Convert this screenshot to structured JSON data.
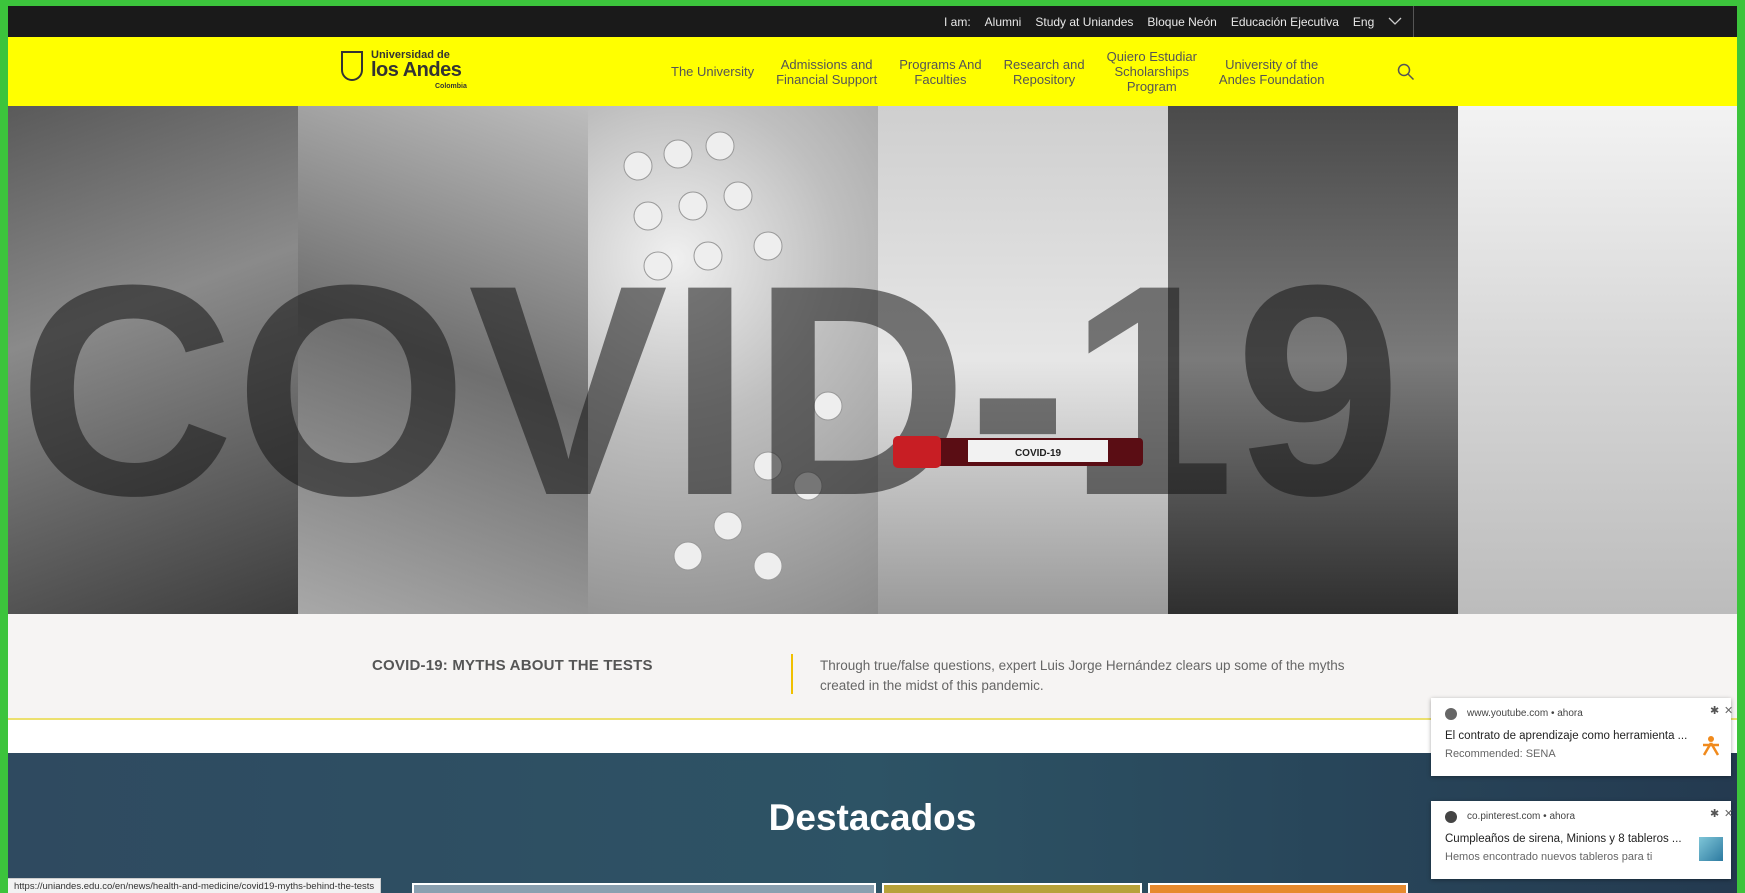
{
  "topbar": {
    "iam_label": "I am:",
    "links": [
      "Alumni",
      "Study at Uniandes",
      "Bloque Neón",
      "Educación Ejecutiva"
    ],
    "language": "Eng"
  },
  "logo": {
    "line1": "Universidad de",
    "line2": "los Andes",
    "line3": "Colombia"
  },
  "nav": {
    "items": [
      {
        "line1": "The University",
        "line2": "",
        "line3": ""
      },
      {
        "line1": "Admissions and",
        "line2": "Financial Support",
        "line3": ""
      },
      {
        "line1": "Programs And",
        "line2": "Faculties",
        "line3": ""
      },
      {
        "line1": "Research and",
        "line2": "Repository",
        "line3": ""
      },
      {
        "line1": "Quiero Estudiar",
        "line2": "Scholarships",
        "line3": "Program"
      },
      {
        "line1": "University of the",
        "line2": "Andes Foundation",
        "line3": ""
      }
    ]
  },
  "hero": {
    "big_text": "COVID-19",
    "tube_label": "COVID-19"
  },
  "caption": {
    "title": "COVID-19: MYTHS ABOUT THE TESTS",
    "description": "Through true/false questions, expert Luis Jorge Hernández clears up some of the myths created in the midst of this pandemic."
  },
  "featured": {
    "heading": "Destacados"
  },
  "status_url": "https://uniandes.edu.co/en/news/health-and-medicine/covid19-myths-behind-the-tests",
  "notifications": [
    {
      "site": "www.youtube.com",
      "time": "ahora",
      "title": "El contrato de aprendizaje como herramienta ...",
      "subtitle": "Recommended: SENA"
    },
    {
      "site": "co.pinterest.com",
      "time": "ahora",
      "title": "Cumpleaños de sirena, Minions y 8 tableros ...",
      "subtitle": "Hemos encontrado nuevos tableros para ti"
    }
  ],
  "colors": {
    "header_bg": "#ffff00",
    "topbar_bg": "#1a1a1a",
    "accent": "#f0c000",
    "featured_bg": "#2d4a60"
  }
}
